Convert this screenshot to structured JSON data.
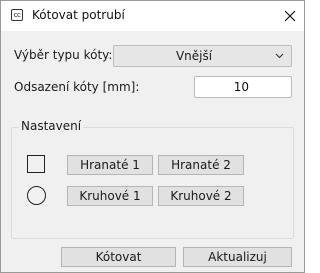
{
  "window": {
    "title": "Kótovat potrubí",
    "app_icon_text": "cc"
  },
  "dimension_type": {
    "label": "Výběr typu kóty:",
    "selected": "Vnější"
  },
  "dimension_offset": {
    "label": "Odsazení kóty [mm]:",
    "value": "10"
  },
  "settings": {
    "title": "Nastavení",
    "square_buttons": [
      "Hranaté 1",
      "Hranaté 2"
    ],
    "round_buttons": [
      "Kruhové 1",
      "Kruhové 2"
    ]
  },
  "actions": {
    "dimension_label": "Kótovat",
    "update_label": "Aktualizuj"
  }
}
